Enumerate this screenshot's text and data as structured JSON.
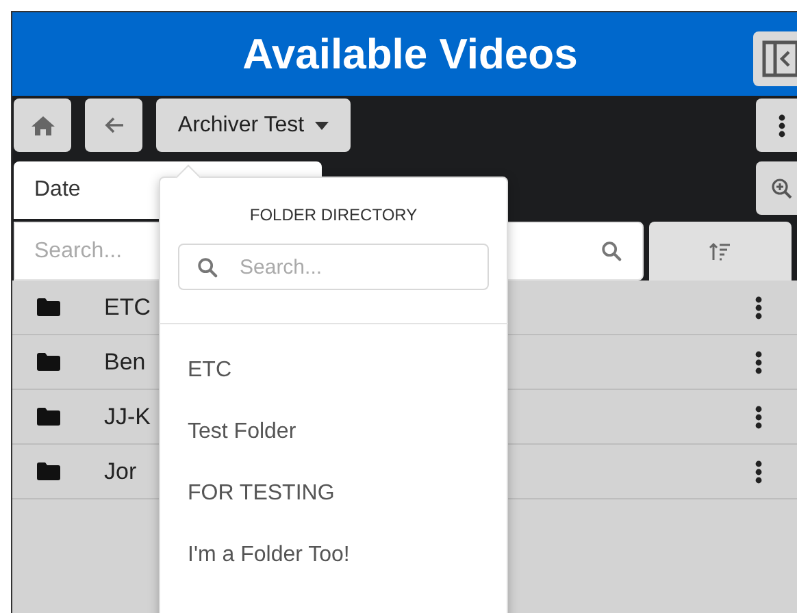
{
  "header": {
    "title": "Available Videos"
  },
  "toolbar": {
    "folder_button": "Archiver Test"
  },
  "sort_field": {
    "value": "Date"
  },
  "search": {
    "placeholder": "Search..."
  },
  "folders": [
    {
      "name": "ETC"
    },
    {
      "name": "Ben"
    },
    {
      "name": "JJ-K"
    },
    {
      "name": "Jor"
    }
  ],
  "folder_directory": {
    "title": "FOLDER DIRECTORY",
    "search": {
      "placeholder": "Search..."
    },
    "items": [
      {
        "label": "ETC"
      },
      {
        "label": "Test Folder"
      },
      {
        "label": "FOR TESTING"
      },
      {
        "label": "I'm a Folder Too!"
      }
    ]
  }
}
